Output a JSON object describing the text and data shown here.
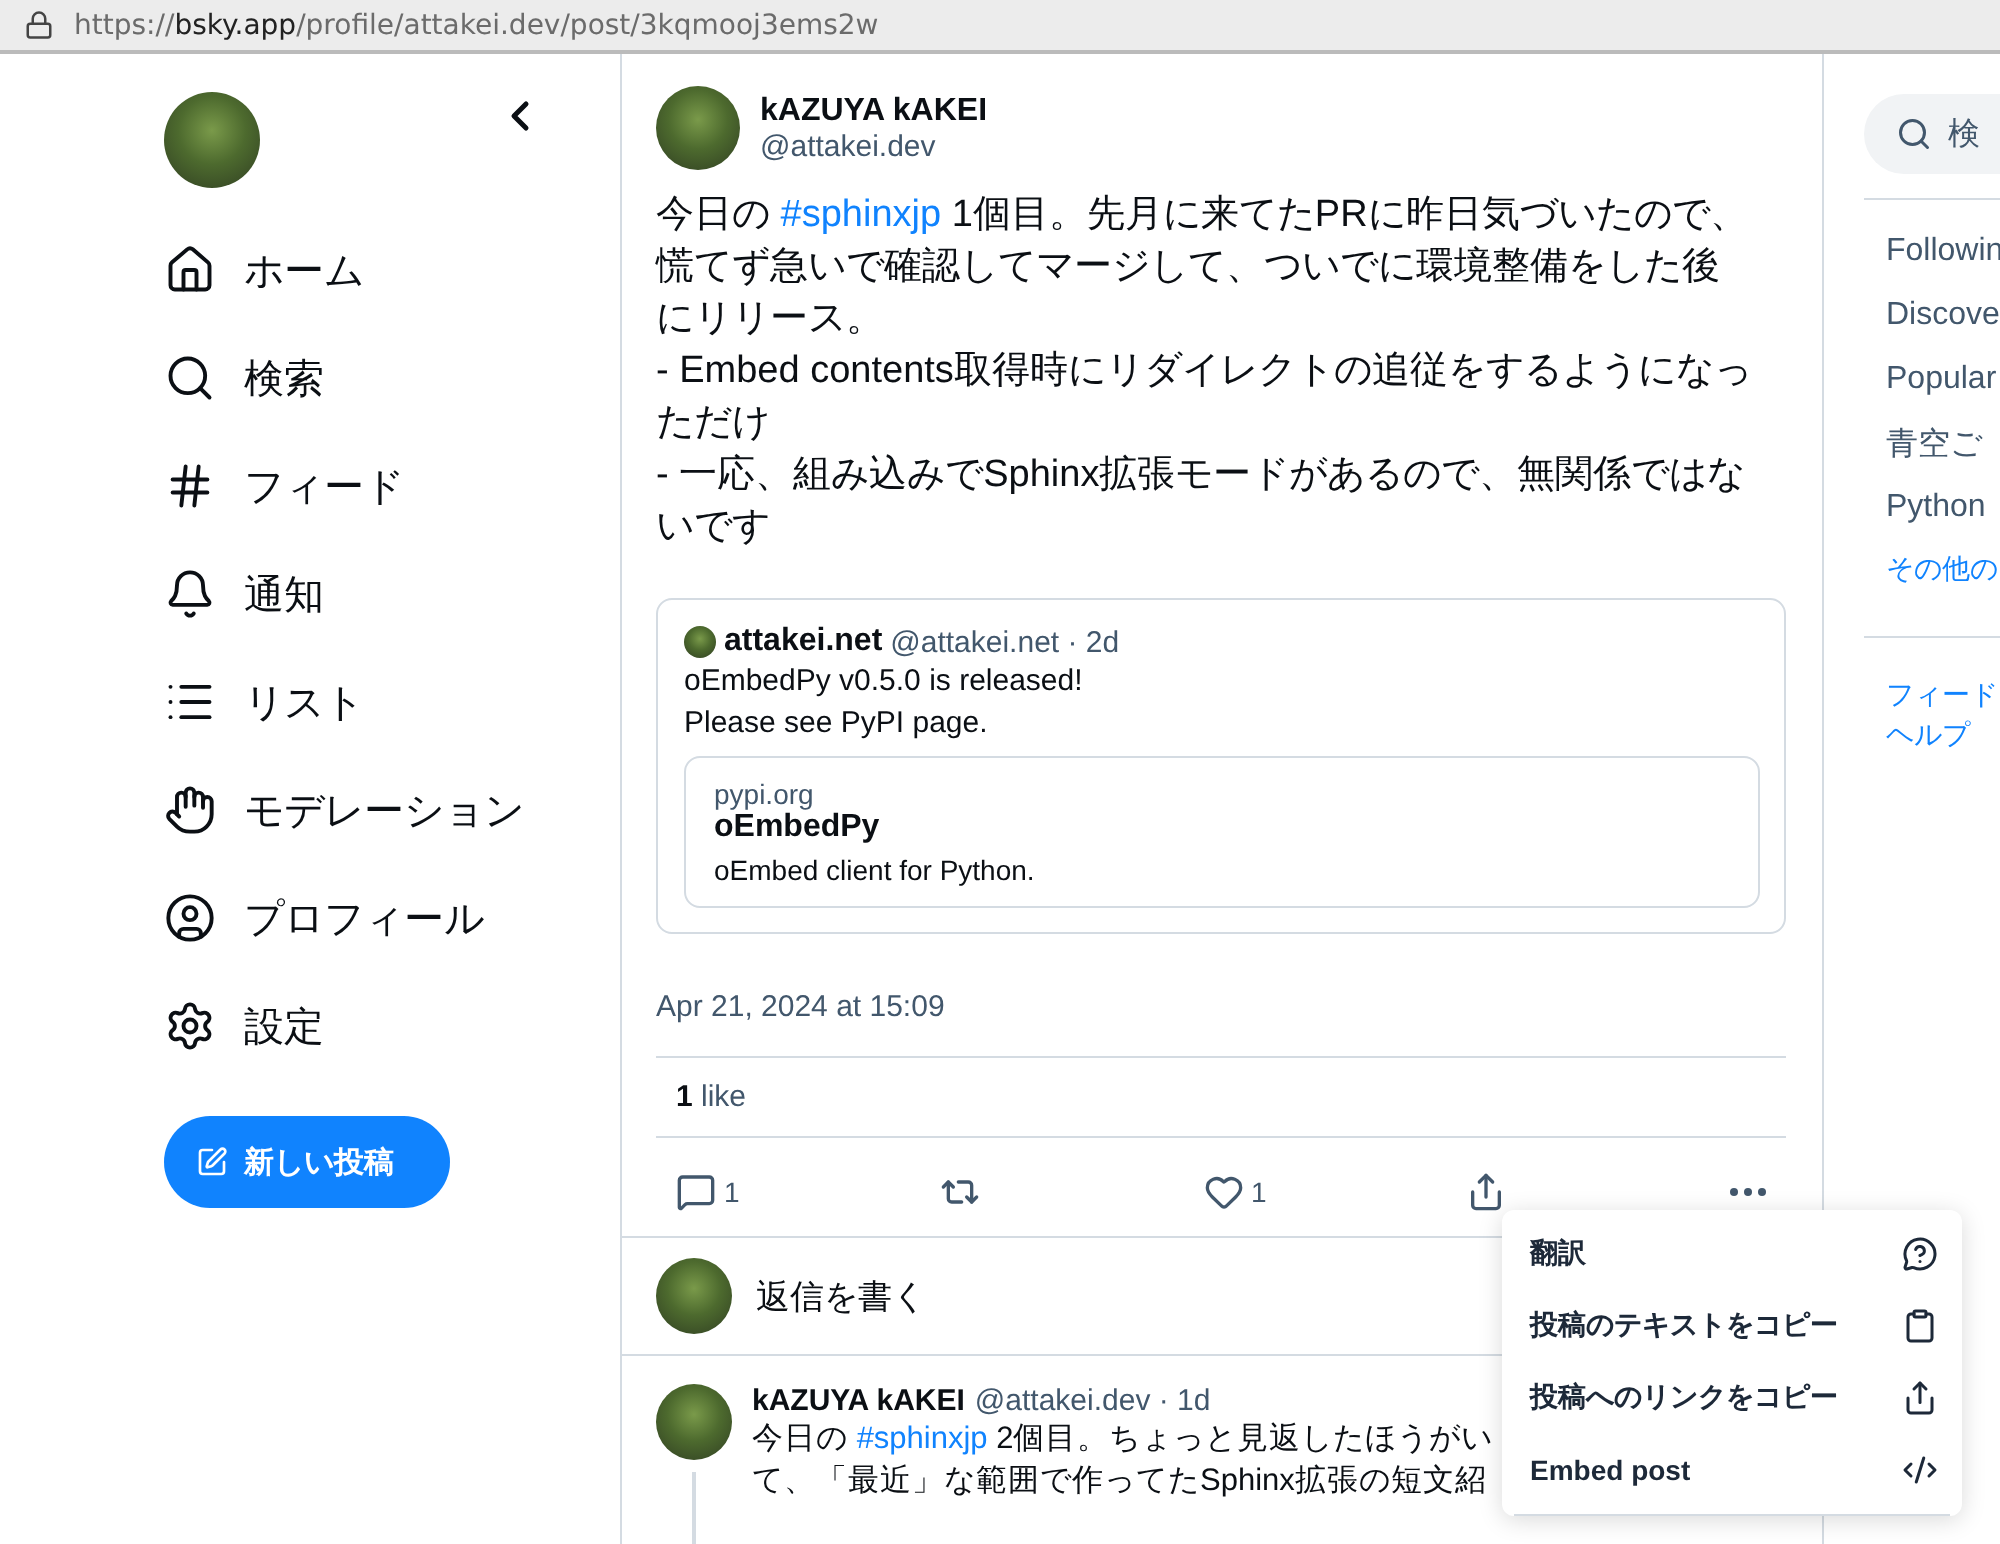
{
  "address_bar": {
    "scheme": "https://",
    "host": "bsky.app",
    "path": "/profile/attakei.dev/post/3kqmooj3ems2w"
  },
  "nav": {
    "items": [
      {
        "kind": "home",
        "label": "ホーム"
      },
      {
        "kind": "search",
        "label": "検索"
      },
      {
        "kind": "feeds",
        "label": "フィード"
      },
      {
        "kind": "notifications",
        "label": "通知"
      },
      {
        "kind": "lists",
        "label": "リスト"
      },
      {
        "kind": "moderation",
        "label": "モデレーション"
      },
      {
        "kind": "profile",
        "label": "プロフィール"
      },
      {
        "kind": "settings",
        "label": "設定"
      }
    ],
    "new_post": "新しい投稿"
  },
  "post": {
    "display_name": "kAZUYA kAKEI",
    "handle": "@attakei.dev",
    "paragraphs": [
      [
        {
          "kind": "text",
          "text": "今日の "
        },
        {
          "kind": "tag",
          "text": "#sphinxjp"
        },
        {
          "kind": "text",
          "text": " 1個目。先月に来てたPRに昨日気づいたので、慌てず急いで確認してマージして、ついでに環境整備をした後にリリース。"
        }
      ],
      [
        {
          "kind": "text",
          "text": "- Embed contents取得時にリダイレクトの追従をするようになっただけ"
        }
      ],
      [
        {
          "kind": "text",
          "text": "- 一応、組み込みでSphinx拡張モードがあるので、無関係ではないです"
        }
      ]
    ],
    "quote": {
      "display_name": "attakei.net",
      "meta": "@attakei.net · 2d",
      "lines": [
        "oEmbedPy v0.5.0 is released!",
        "Please see PyPI page."
      ],
      "link": {
        "domain": "pypi.org",
        "title": "oEmbedPy",
        "description": "oEmbed client for Python."
      }
    },
    "timestamp": "Apr 21, 2024 at 15:09",
    "likes": {
      "count": "1",
      "label": "like"
    },
    "actions": [
      {
        "kind": "reply",
        "count": "1"
      },
      {
        "kind": "repost"
      },
      {
        "kind": "like",
        "count": "1"
      },
      {
        "kind": "share"
      },
      {
        "kind": "more"
      }
    ]
  },
  "reply_prompt": "返信を書く",
  "reply": {
    "display_name": "kAZUYA kAKEI",
    "meta": "@attakei.dev · 1d",
    "lines": [
      [
        {
          "kind": "text",
          "text": "今日の "
        },
        {
          "kind": "tag",
          "text": "#sphinxjp"
        },
        {
          "kind": "text",
          "text": " 2個目。ちょっと見返したほうがい"
        }
      ],
      [
        {
          "kind": "text",
          "text": "て、「最近」な範囲で作ってたSphinx拡張の短文紹"
        }
      ]
    ]
  },
  "menu": [
    {
      "kind": "translate",
      "label": "翻訳"
    },
    {
      "kind": "copy_text",
      "label": "投稿のテキストをコピー"
    },
    {
      "kind": "copy_link",
      "label": "投稿へのリンクをコピー"
    },
    {
      "kind": "embed",
      "label": "Embed post"
    }
  ],
  "right": {
    "search_placeholder": "検",
    "feeds": [
      "Followin",
      "Discove",
      "Popular",
      "青空ご",
      "Python"
    ],
    "more_link": "その他の",
    "footer_links": [
      "フィード",
      "ヘルプ"
    ]
  }
}
